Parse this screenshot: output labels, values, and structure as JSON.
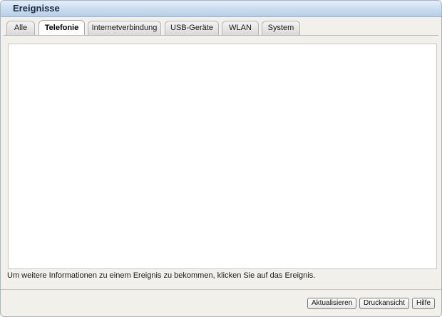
{
  "panel": {
    "title": "Ereignisse"
  },
  "tabs": [
    {
      "label": "Alle",
      "active": false
    },
    {
      "label": "Telefonie",
      "active": true
    },
    {
      "label": "Internetverbindung",
      "active": false
    },
    {
      "label": "USB-Geräte",
      "active": false
    },
    {
      "label": "WLAN",
      "active": false
    },
    {
      "label": "System",
      "active": false
    }
  ],
  "info_text": "Um weitere Informationen zu einem Ereignis zu bekommen, klicken Sie auf das Ereignis.",
  "buttons": {
    "refresh": "Aktualisieren",
    "print": "Druckansicht",
    "help": "Hilfe"
  },
  "colors": {
    "header_gradient_top": "#e3edf8",
    "header_gradient_bottom": "#b8cee6",
    "panel_background": "#f2f0eb",
    "content_background": "#ffffff"
  }
}
